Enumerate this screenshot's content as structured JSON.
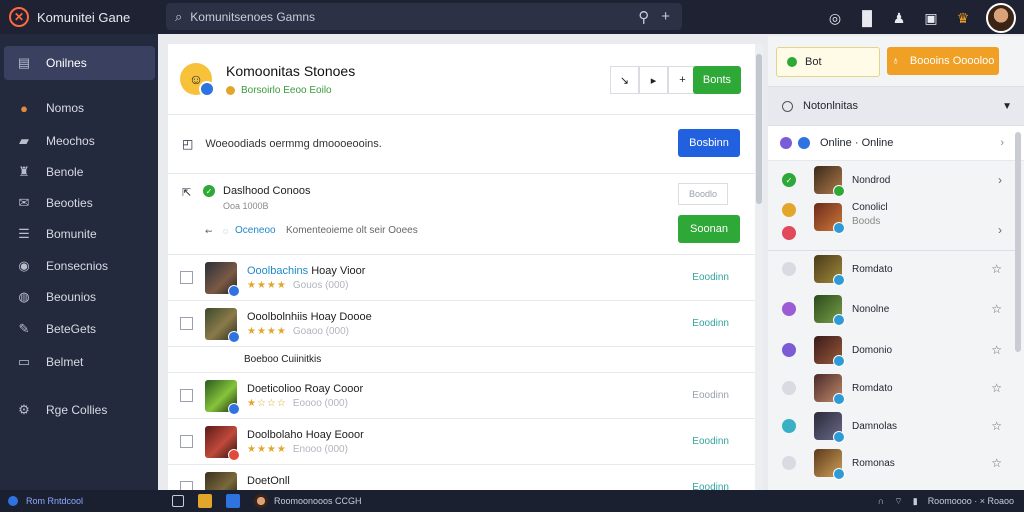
{
  "app": {
    "title": "Komunitei Gane"
  },
  "search": {
    "value": "Komunitsenoes Gamns",
    "icon": "search-icon",
    "extra": "+"
  },
  "topbar": {
    "icons": [
      "compass-icon",
      "stats-icon",
      "users-icon",
      "calendar-icon",
      "trophy-icon"
    ]
  },
  "sidebar": {
    "items": [
      {
        "label": "Onilnes",
        "icon": "monitor-icon"
      },
      {
        "label": "Nomos",
        "icon": "avatar-icon"
      },
      {
        "label": "Meochos",
        "icon": "chat-icon"
      },
      {
        "label": "Benole",
        "icon": "people-icon"
      },
      {
        "label": "Beooties",
        "icon": "mail-icon"
      },
      {
        "label": "Bomunite",
        "icon": "list-icon"
      },
      {
        "label": "Eonsecnios",
        "icon": "groups-icon"
      },
      {
        "label": "Beounios",
        "icon": "chat-bubble-icon"
      },
      {
        "label": "BeteGets",
        "icon": "edit-icon"
      },
      {
        "label": "Belmet",
        "icon": "document-icon"
      },
      {
        "label": "Rge Collies",
        "icon": "settings-icon"
      }
    ]
  },
  "main": {
    "header": {
      "title": "Komoonitas Stonoes",
      "subtitle": "Borsoirlo Eeoo Eoilo",
      "action_label": "Bonts"
    },
    "toolbar": [
      "↘",
      "▸",
      "+"
    ],
    "row1": {
      "text": "Woeoodiads oermmg dmoooeooins.",
      "button": "Bosbinn"
    },
    "row2": {
      "title": "Daslhood Conoos",
      "sub": "Ooa 1000B",
      "tag": "Boodlo",
      "info_label": "Oceneoo",
      "info_text": "Komenteoieme olt seir Ooees",
      "button": "Soonan"
    },
    "rows": [
      {
        "title_hl": "Ooolbachins",
        "title": "Hoay Vioor",
        "rating": "★★★★",
        "meta": "Gouos (000)",
        "link": "Eoodinn"
      },
      {
        "title_hl": "Ooolbolnhiis",
        "title": "Hoay Doooe",
        "rating": "★★★★",
        "meta": "Goaoo (000)",
        "link": "Eoodinn"
      }
    ],
    "section_label": "Boeboo Cuiinitkis",
    "rows2": [
      {
        "title": "Doeticolioo Roay Cooor",
        "rating": "★☆☆☆",
        "meta": "Eoooo (000)",
        "link": "Eoodinn"
      },
      {
        "title": "Doolbolaho Hoay Eooor",
        "rating": "★★★★",
        "meta": "Enooo (000)",
        "link": "Eoodinn"
      },
      {
        "title": "DoetOnll",
        "rating": "★★★★",
        "meta": "",
        "link": "Eoodinn"
      }
    ]
  },
  "right": {
    "btn_left": "Bot",
    "btn_right": "Boooins Ooooloo",
    "section": "Notonlnitas",
    "online_label": "Online · Online",
    "members": [
      {
        "name": "Nondrod",
        "sub": ""
      },
      {
        "name": "Conolicl",
        "sub": "Boods"
      },
      {
        "name": "Romdato",
        "sub": ""
      },
      {
        "name": "Nonolne",
        "sub": ""
      },
      {
        "name": "Domonio",
        "sub": ""
      },
      {
        "name": "Romdato",
        "sub": ""
      },
      {
        "name": "Damnolas",
        "sub": ""
      },
      {
        "name": "Romonas",
        "sub": ""
      }
    ]
  },
  "taskbar": {
    "left": "Rom Rntdcool",
    "title": "Roomoonooos CCGH",
    "right": "Roomoooo · × Roaoo"
  }
}
